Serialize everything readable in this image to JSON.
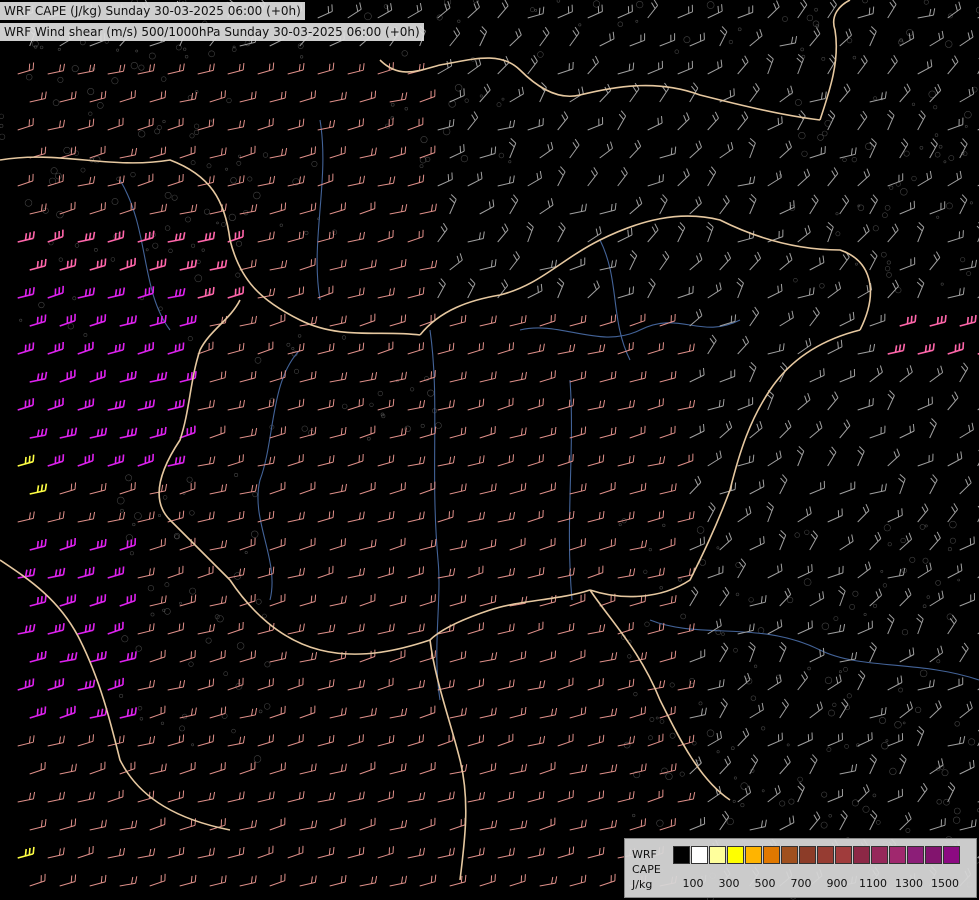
{
  "titles": {
    "line1": "WRF CAPE (J/kg) Sunday 30-03-2025 06:00 (+0h)",
    "line2": "WRF Wind shear (m/s) 500/1000hPa Sunday 30-03-2025 06:00 (+0h)"
  },
  "legend": {
    "label_lines": [
      "WRF",
      "CAPE",
      "J/kg"
    ],
    "colors": [
      "#000000",
      "#ffffff",
      "#ffff9c",
      "#ffff00",
      "#ffb400",
      "#e07800",
      "#a0501e",
      "#8c3c28",
      "#963c32",
      "#a03c3c",
      "#8c2846",
      "#96285a",
      "#a0286e",
      "#8c1e78",
      "#82146e",
      "#8c0a82"
    ],
    "ticks": [
      "100",
      "300",
      "500",
      "700",
      "900",
      "1100",
      "1300",
      "1500"
    ]
  },
  "map_colors": {
    "background": "#000000",
    "terrain_contours": "#7a7a7a",
    "borders": "#e6c8a0",
    "rivers": "#4a6ea8",
    "barb_low": "#a0a0a0",
    "barb_mid": "#e0908a",
    "barb_strong": "#ff66aa",
    "barb_max": "#dd22ee",
    "barb_yellow": "#ffff44"
  }
}
